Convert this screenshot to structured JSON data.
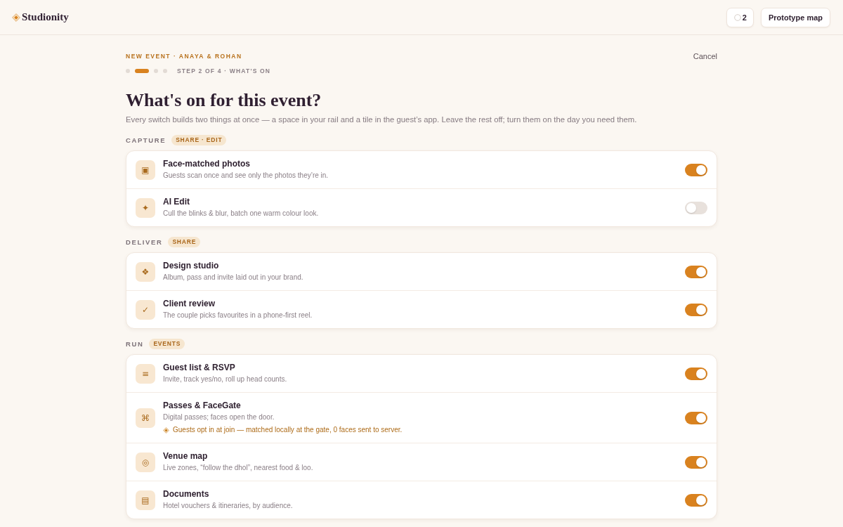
{
  "header": {
    "brand": "Studionity",
    "count_button": "2",
    "map_button": "Prototype map"
  },
  "wizard": {
    "eyebrow": "NEW EVENT · ANAYA & ROHAN",
    "cancel": "Cancel",
    "steps": [
      {
        "selected": false
      },
      {
        "selected": true
      },
      {
        "selected": false
      },
      {
        "selected": false
      }
    ],
    "step_label": "STEP 2 OF 4 · WHAT'S ON"
  },
  "heading": "What's on for this event?",
  "intro": "Every switch builds two things at once — a space in your rail and a tile in the guest’s app. Leave the rest off; turn them on the day you need them.",
  "sections": [
    {
      "label": "CAPTURE",
      "badge": "SHARE · EDIT",
      "items": [
        {
          "icon": "▣",
          "title": "Face-matched photos",
          "description": "Guests scan once and see only the photos they’re in.",
          "on": true
        },
        {
          "icon": "✦",
          "title": "AI Edit",
          "description": "Cull the blinks & blur, batch one warm colour look.",
          "on": false
        }
      ]
    },
    {
      "label": "DELIVER",
      "badge": "SHARE",
      "items": [
        {
          "icon": "❖",
          "title": "Design studio",
          "description": "Album, pass and invite laid out in your brand.",
          "on": true
        },
        {
          "icon": "✓",
          "title": "Client review",
          "description": "The couple picks favourites in a phone-first reel.",
          "on": true
        }
      ]
    },
    {
      "label": "RUN",
      "badge": "EVENTS",
      "items": [
        {
          "icon": "≡",
          "title": "Guest list & RSVP",
          "description": "Invite, track yes/no, roll up head counts.",
          "on": true
        },
        {
          "icon": "⌘",
          "title": "Passes & FaceGate",
          "description": "Digital passes; faces open the door.",
          "note": "Guests opt in at join — matched locally at the gate, 0 faces sent to server.",
          "on": true
        },
        {
          "icon": "◎",
          "title": "Venue map",
          "description": "Live zones, “follow the dhol”, nearest food & loo.",
          "on": true
        },
        {
          "icon": "▤",
          "title": "Documents",
          "description": "Hotel vouchers & itineraries, by audience.",
          "on": true
        }
      ]
    }
  ]
}
